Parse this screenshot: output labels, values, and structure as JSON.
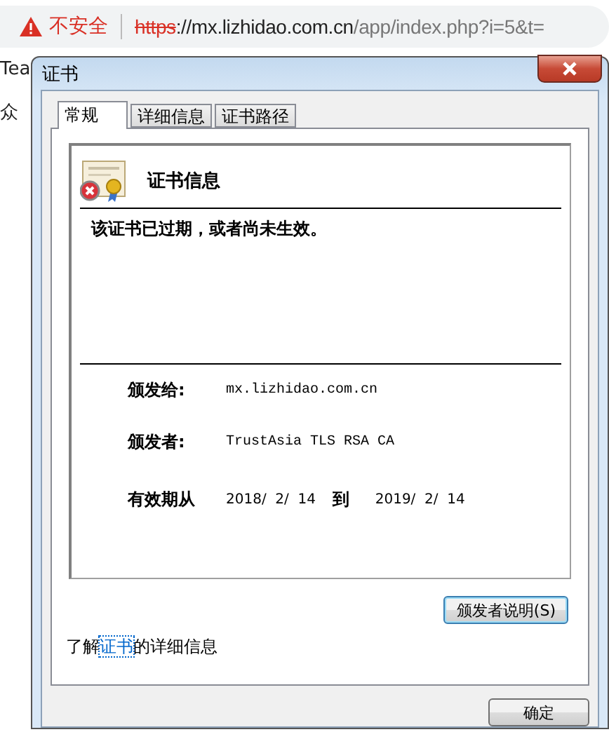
{
  "browser": {
    "security_label": "不安全",
    "url": {
      "scheme": "https",
      "host": "://mx.lizhidao.com.cn",
      "path": "/app/index.php?i=5&t="
    }
  },
  "page": {
    "texts": [
      "Tea",
      "众"
    ]
  },
  "dialog": {
    "title": "证书",
    "tabs": [
      {
        "label": "常规",
        "selected": true
      },
      {
        "label": "详细信息",
        "selected": false
      },
      {
        "label": "证书路径",
        "selected": false
      }
    ],
    "heading": "证书信息",
    "message": "该证书已过期，或者尚未生效。",
    "fields": [
      {
        "label": "颁发给:",
        "value": "mx.lizhidao.com.cn"
      },
      {
        "label": "颁发者:",
        "value": "TrustAsia TLS RSA CA"
      }
    ],
    "validity": {
      "label": "有效期从",
      "from": "2018/  2/  14",
      "to_label": "到",
      "to": "2019/  2/  14"
    },
    "issuer_button": "颁发者说明(S)",
    "learn_more": {
      "before": "了解",
      "link": "证书",
      "after": "的详细信息"
    },
    "ok_button": "确定"
  }
}
